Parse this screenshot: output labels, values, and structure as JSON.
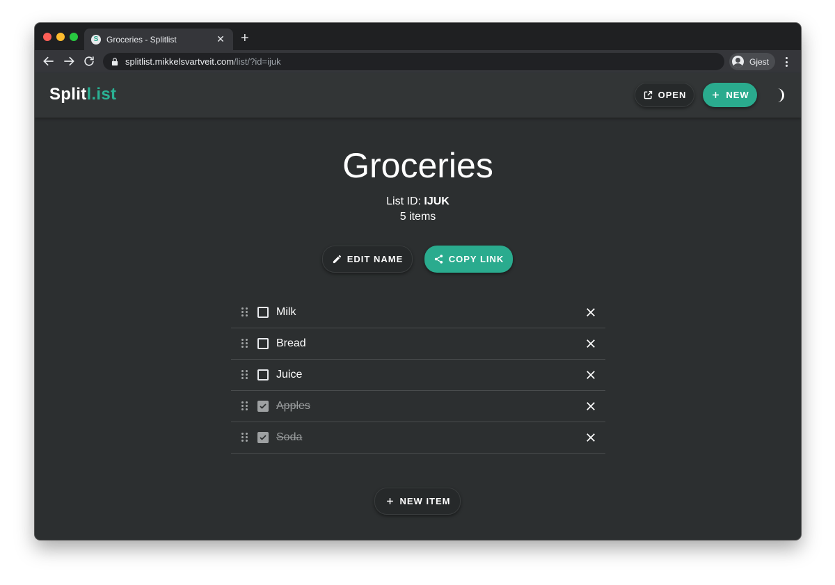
{
  "browser": {
    "tab_title": "Groceries - Splitlist",
    "favicon_letter": "S",
    "url_host": "splitlist.mikkelsvartveit.com",
    "url_path": "/list/?id=ijuk",
    "profile_name": "Gjest"
  },
  "app": {
    "logo_main": "Split",
    "logo_accent": "l.ist",
    "open_label": "OPEN",
    "new_label": "NEW",
    "accent_color": "#2ab194"
  },
  "list": {
    "title": "Groceries",
    "id_prefix": "List ID: ",
    "id_value": "IJUK",
    "count_text": "5 items",
    "edit_name_label": "EDIT NAME",
    "copy_link_label": "COPY LINK",
    "new_item_label": "NEW ITEM",
    "items": [
      {
        "label": "Milk",
        "checked": false
      },
      {
        "label": "Bread",
        "checked": false
      },
      {
        "label": "Juice",
        "checked": false
      },
      {
        "label": "Apples",
        "checked": true
      },
      {
        "label": "Soda",
        "checked": true
      }
    ]
  }
}
